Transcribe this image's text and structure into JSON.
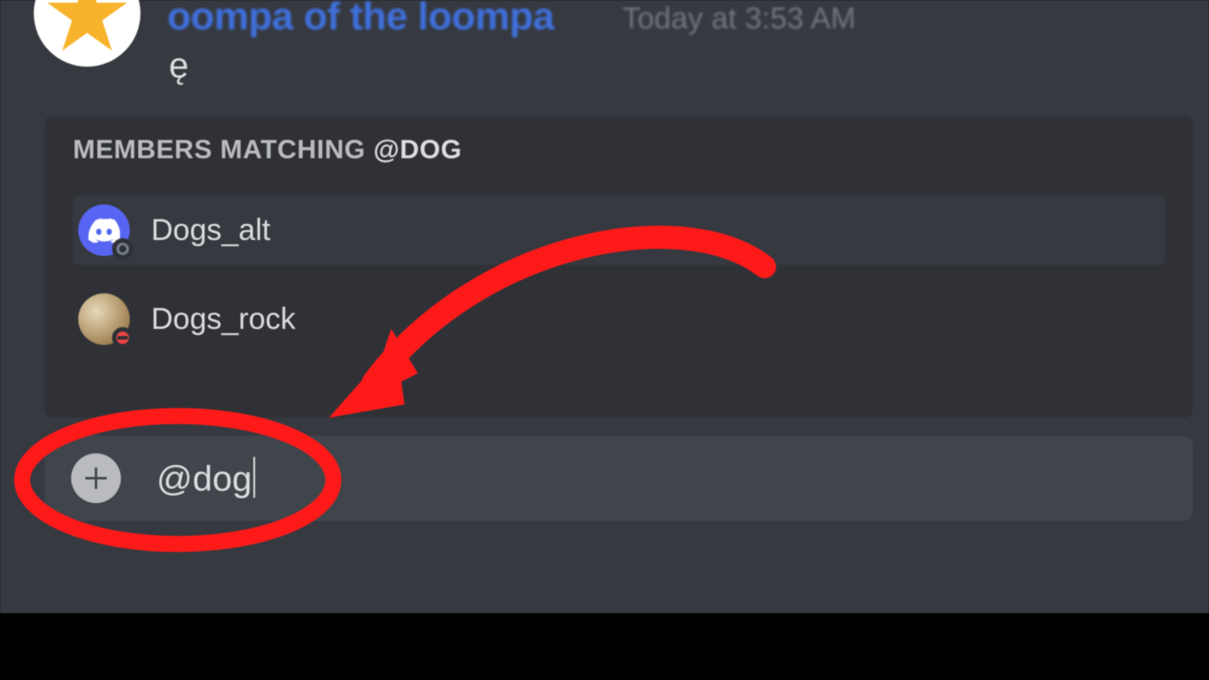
{
  "message": {
    "username": "oompa of the loompa",
    "timestamp": "Today at 3:53 AM",
    "content": "ę"
  },
  "autocomplete": {
    "header_prefix": "MEMBERS MATCHING ",
    "header_query": "@dog",
    "items": [
      {
        "name": "Dogs_alt",
        "avatar": "discord",
        "status": "offline"
      },
      {
        "name": "Dogs_rock",
        "avatar": "photo",
        "status": "dnd"
      }
    ]
  },
  "composer": {
    "text": "@dog"
  },
  "colors": {
    "annotation": "#ff1a1a",
    "username": "#3f70dd"
  }
}
